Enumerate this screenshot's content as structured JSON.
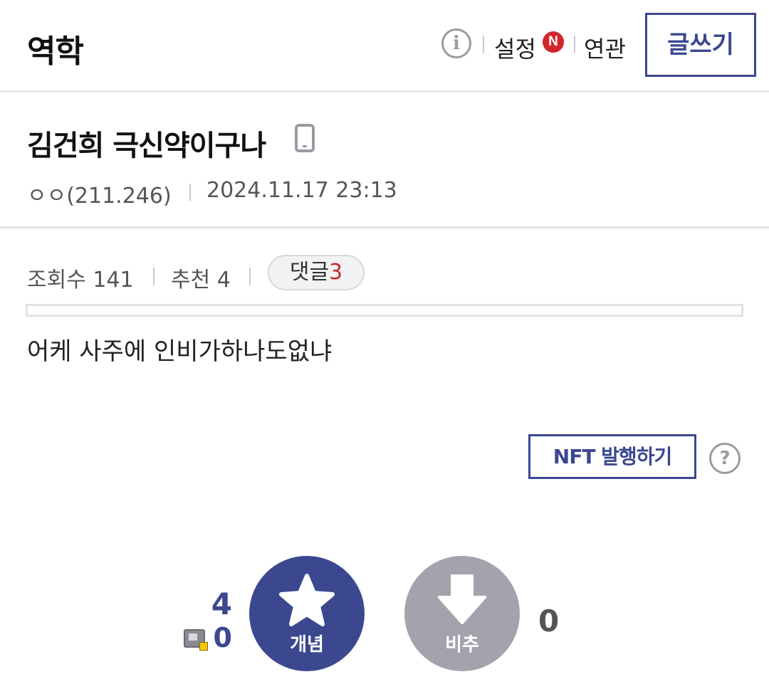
{
  "header": {
    "gallery_title": "역학",
    "info_icon": "i",
    "settings_label": "설정",
    "new_badge": "N",
    "related_label": "연관",
    "write_button": "글쓰기"
  },
  "post": {
    "title": "김건희 극신약이구나",
    "author": "ㅇㅇ(211.246)",
    "date": "2024.11.17 23:13",
    "views": "조회수 141",
    "recommend": "추천 4",
    "comments_label": "댓글",
    "comments_count": "3",
    "body": "어케 사주에 인비가하나도없냐"
  },
  "actions": {
    "nft_button": "NFT 발행하기",
    "help_icon": "?",
    "upvote_count": "4",
    "fixed_upvote_count": "0",
    "upvote_label": "개념",
    "downvote_label": "비추",
    "downvote_count": "0"
  },
  "colors": {
    "accent": "#3b4890",
    "downvote": "#a3a3ae",
    "badge": "#d0262c",
    "comment_count": "#c62828"
  },
  "icons": {
    "info": "info-icon",
    "new_badge": "new-badge-icon",
    "mobile": "mobile-phone-icon",
    "help": "question-icon",
    "fixed_user": "fixed-user-icon",
    "upvote": "star-icon",
    "downvote": "arrow-down-icon"
  }
}
